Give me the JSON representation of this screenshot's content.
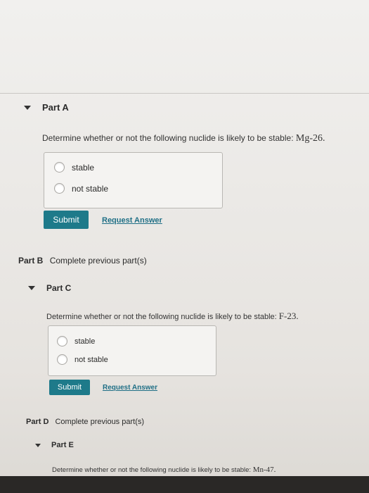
{
  "partA": {
    "title": "Part A",
    "question": "Determine whether or not the following nuclide is likely to be stable:",
    "nuclide": "Mg-26.",
    "options": [
      "stable",
      "not stable"
    ],
    "submit_label": "Submit",
    "request_label": "Request Answer"
  },
  "partB": {
    "label": "Part B",
    "status": "Complete previous part(s)"
  },
  "partC": {
    "title": "Part C",
    "question": "Determine whether or not the following nuclide is likely to be stable:",
    "nuclide": "F-23.",
    "options": [
      "stable",
      "not stable"
    ],
    "submit_label": "Submit",
    "request_label": "Request Answer"
  },
  "partD": {
    "label": "Part D",
    "status": "Complete previous part(s)"
  },
  "partE": {
    "title": "Part E",
    "question": "Determine whether or not the following nuclide is likely to be stable:",
    "nuclide": "Mn-47."
  },
  "colors": {
    "button": "#1e7a8a",
    "link": "#1f6f86"
  },
  "icons": {
    "collapse": "caret-down-icon"
  }
}
